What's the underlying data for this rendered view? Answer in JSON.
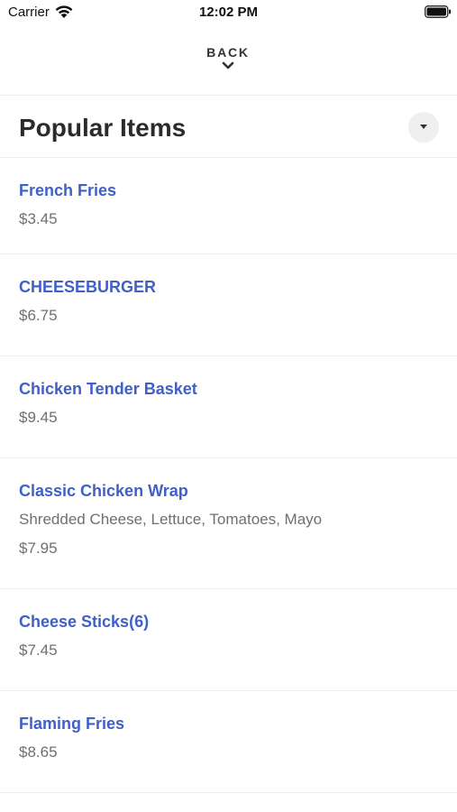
{
  "status_bar": {
    "carrier": "Carrier",
    "time": "12:02 PM",
    "wifi_icon": "wifi-icon",
    "battery_icon": "battery-icon"
  },
  "header": {
    "back_label": "BACK",
    "back_icon": "chevron-down-icon"
  },
  "section": {
    "title": "Popular Items",
    "toggle_icon": "caret-down-icon"
  },
  "colors": {
    "item_name": "#3f5fc9",
    "secondary_text": "#6f6f6f",
    "divider": "#ececec"
  },
  "items": [
    {
      "name": "French Fries",
      "description": "",
      "price": "$3.45"
    },
    {
      "name": "CHEESEBURGER",
      "description": "",
      "price": "$6.75"
    },
    {
      "name": "Chicken Tender Basket",
      "description": "",
      "price": "$9.45"
    },
    {
      "name": "Classic Chicken Wrap",
      "description": "Shredded Cheese, Lettuce, Tomatoes, Mayo",
      "price": "$7.95"
    },
    {
      "name": "Cheese Sticks(6)",
      "description": "",
      "price": "$7.45"
    },
    {
      "name": "Flaming Fries",
      "description": "",
      "price": "$8.65"
    }
  ]
}
